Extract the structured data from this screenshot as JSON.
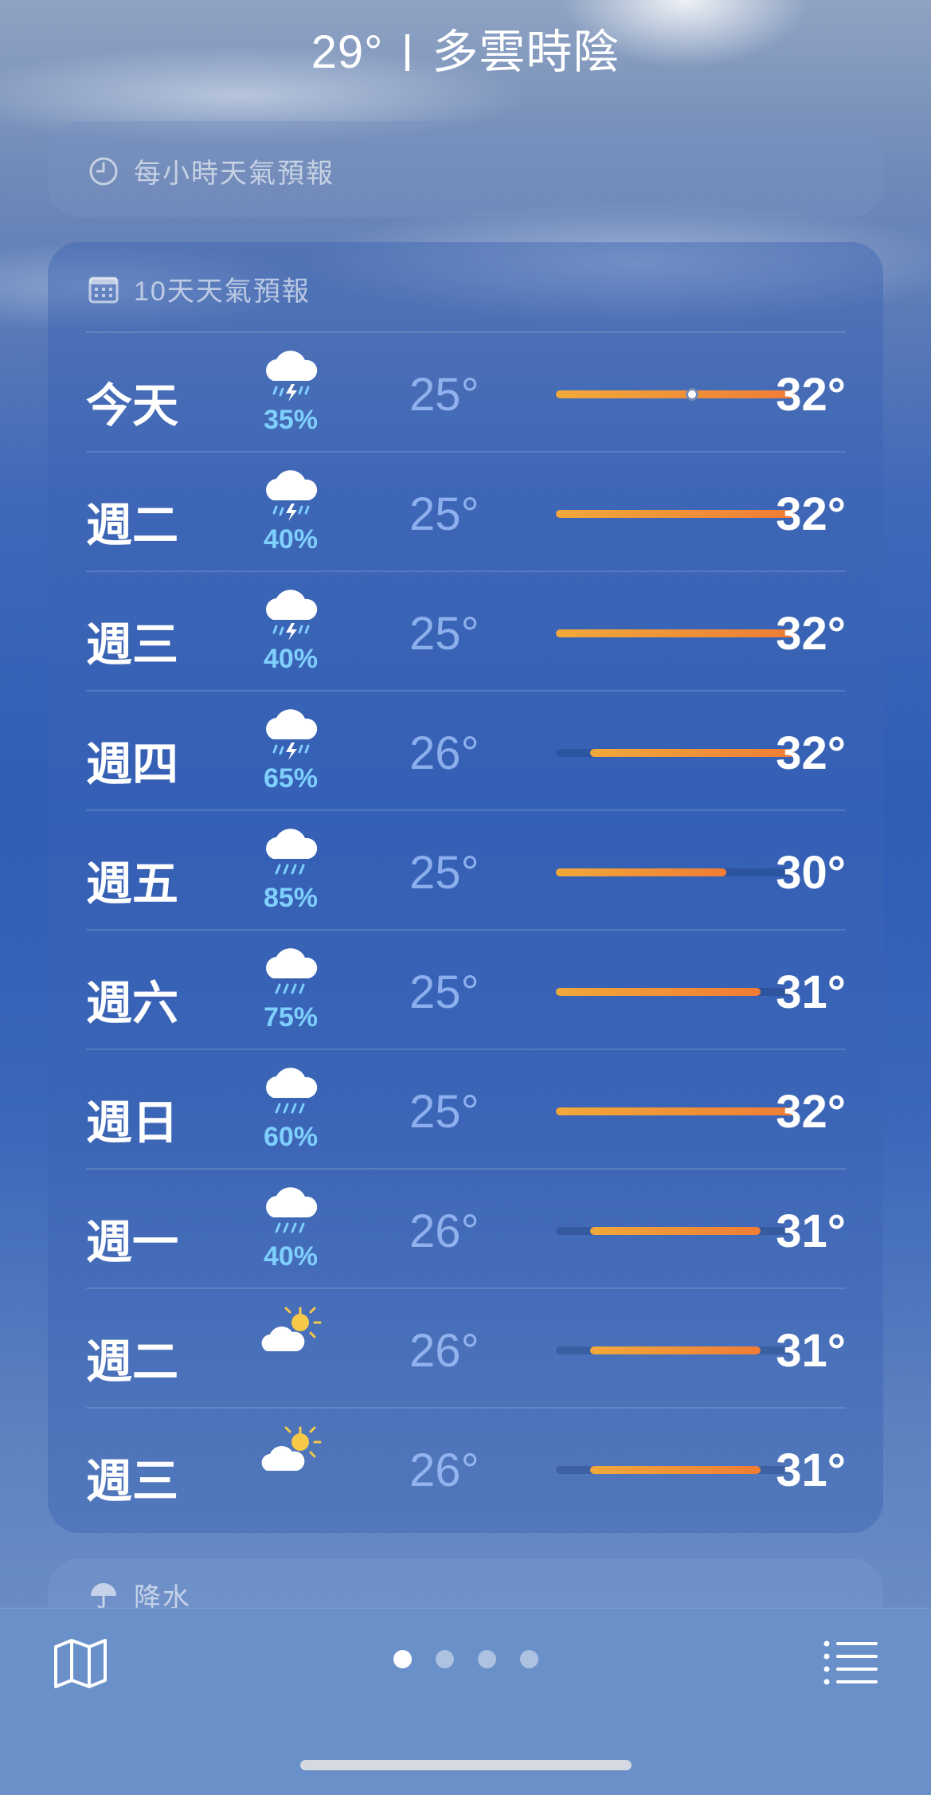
{
  "header": {
    "temp": "29°",
    "condition": "多雲時陰"
  },
  "hourly": {
    "title": "每小時天氣預報",
    "icon": "clock-icon"
  },
  "forecast": {
    "title": "10天天氣預報",
    "icon": "calendar-icon",
    "days": [
      {
        "day": "今天",
        "icon": "thunderstorm",
        "pop": "35%",
        "low": "25°",
        "high": "32°",
        "current_marker": true
      },
      {
        "day": "週二",
        "icon": "thunderstorm",
        "pop": "40%",
        "low": "25°",
        "high": "32°"
      },
      {
        "day": "週三",
        "icon": "thunderstorm",
        "pop": "40%",
        "low": "25°",
        "high": "32°"
      },
      {
        "day": "週四",
        "icon": "thunderstorm",
        "pop": "65%",
        "low": "26°",
        "high": "32°"
      },
      {
        "day": "週五",
        "icon": "rain",
        "pop": "85%",
        "low": "25°",
        "high": "30°"
      },
      {
        "day": "週六",
        "icon": "rain",
        "pop": "75%",
        "low": "25°",
        "high": "31°"
      },
      {
        "day": "週日",
        "icon": "rain",
        "pop": "60%",
        "low": "25°",
        "high": "32°"
      },
      {
        "day": "週一",
        "icon": "rain",
        "pop": "40%",
        "low": "26°",
        "high": "31°"
      },
      {
        "day": "週二",
        "icon": "partly-sunny",
        "pop": "",
        "low": "26°",
        "high": "31°"
      },
      {
        "day": "週三",
        "icon": "partly-sunny",
        "pop": "",
        "low": "26°",
        "high": "31°"
      }
    ]
  },
  "precipitation": {
    "title": "降水",
    "icon": "umbrella-icon"
  },
  "bottom_bar": {
    "map_icon": "map-icon",
    "list_icon": "list-icon",
    "page_count": 4,
    "active_page": 1
  },
  "colors": {
    "bar_start": "#f1a93a",
    "bar_end": "#f07c36",
    "pop_text": "#7fd0ff"
  }
}
